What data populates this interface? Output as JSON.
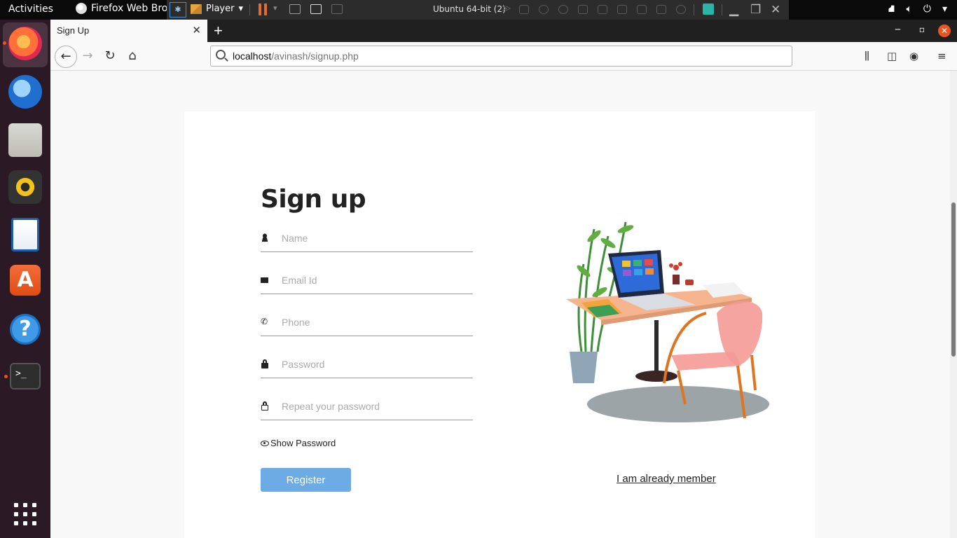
{
  "topbar": {
    "activities": "Activities",
    "app_name": "Firefox Web Browser",
    "player_label": "Player",
    "vm_title": "Ubuntu 64-bit (2)"
  },
  "dock": {
    "items": [
      "firefox",
      "thunderbird",
      "files",
      "rhythmbox",
      "libreoffice-writer",
      "software",
      "help",
      "terminal"
    ]
  },
  "browser": {
    "tab_title": "Sign Up",
    "new_tab": "+",
    "url_host": "localhost",
    "url_path": "/avinash/signup.php"
  },
  "form": {
    "title": "Sign up",
    "name_placeholder": "Name",
    "email_placeholder": "Email Id",
    "phone_placeholder": "Phone",
    "password_placeholder": "Password",
    "repeat_placeholder": "Repeat your password",
    "show_password": "Show Password",
    "register": "Register",
    "member_link": "I am already member"
  },
  "colors": {
    "accent_button": "#6dabe4",
    "ubuntu_orange": "#e95420"
  }
}
